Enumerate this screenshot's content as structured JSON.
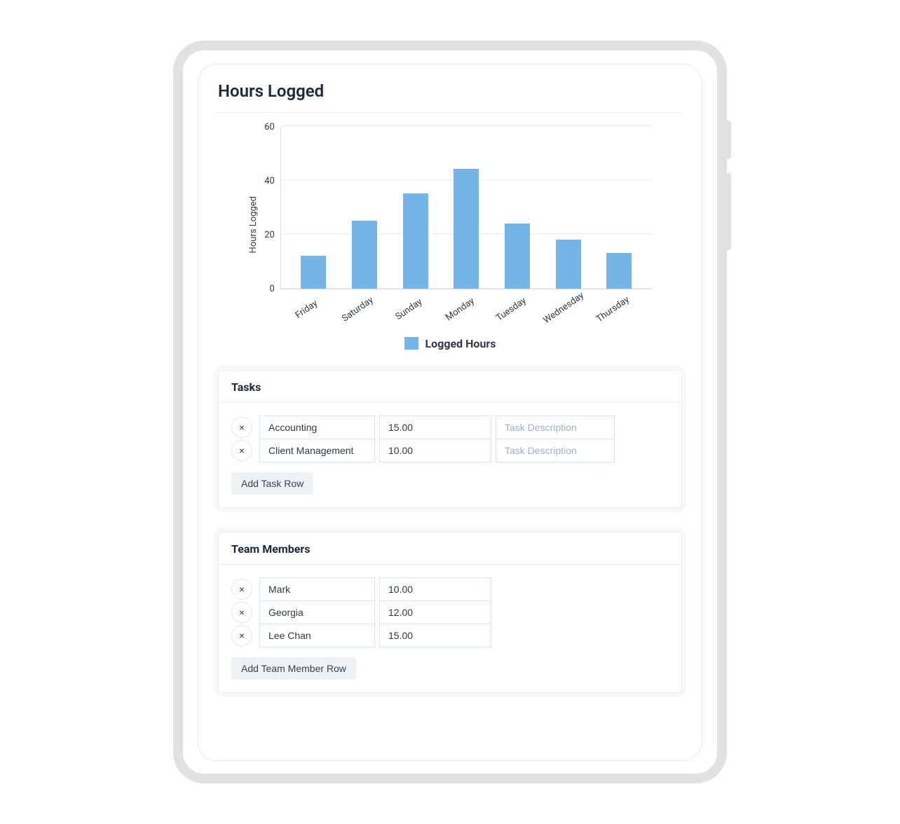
{
  "page_title": "Hours Logged",
  "chart_data": {
    "type": "bar",
    "title": "",
    "xlabel": "",
    "ylabel": "Hours Logged",
    "ylim": [
      0,
      60
    ],
    "yticks": [
      0,
      20,
      40,
      60
    ],
    "categories": [
      "Friday",
      "Saturday",
      "Sunday",
      "Monday",
      "Tuesday",
      "Wednesday",
      "Thursday"
    ],
    "series": [
      {
        "name": "Logged Hours",
        "values": [
          12,
          25,
          35,
          44,
          24,
          18,
          13
        ],
        "color": "#74b4e6"
      }
    ]
  },
  "legend_label": "Logged Hours",
  "tasks": {
    "header": "Tasks",
    "add_label": "Add Task Row",
    "desc_placeholder": "Task Description",
    "rows": [
      {
        "name": "Accounting",
        "hours": "15.00",
        "description": ""
      },
      {
        "name": "Client Management",
        "hours": "10.00",
        "description": ""
      }
    ]
  },
  "team": {
    "header": "Team Members",
    "add_label": "Add Team Member Row",
    "rows": [
      {
        "name": "Mark",
        "hours": "10.00"
      },
      {
        "name": "Georgia",
        "hours": "12.00"
      },
      {
        "name": "Lee Chan",
        "hours": "15.00"
      }
    ]
  },
  "icons": {
    "close": "×"
  }
}
